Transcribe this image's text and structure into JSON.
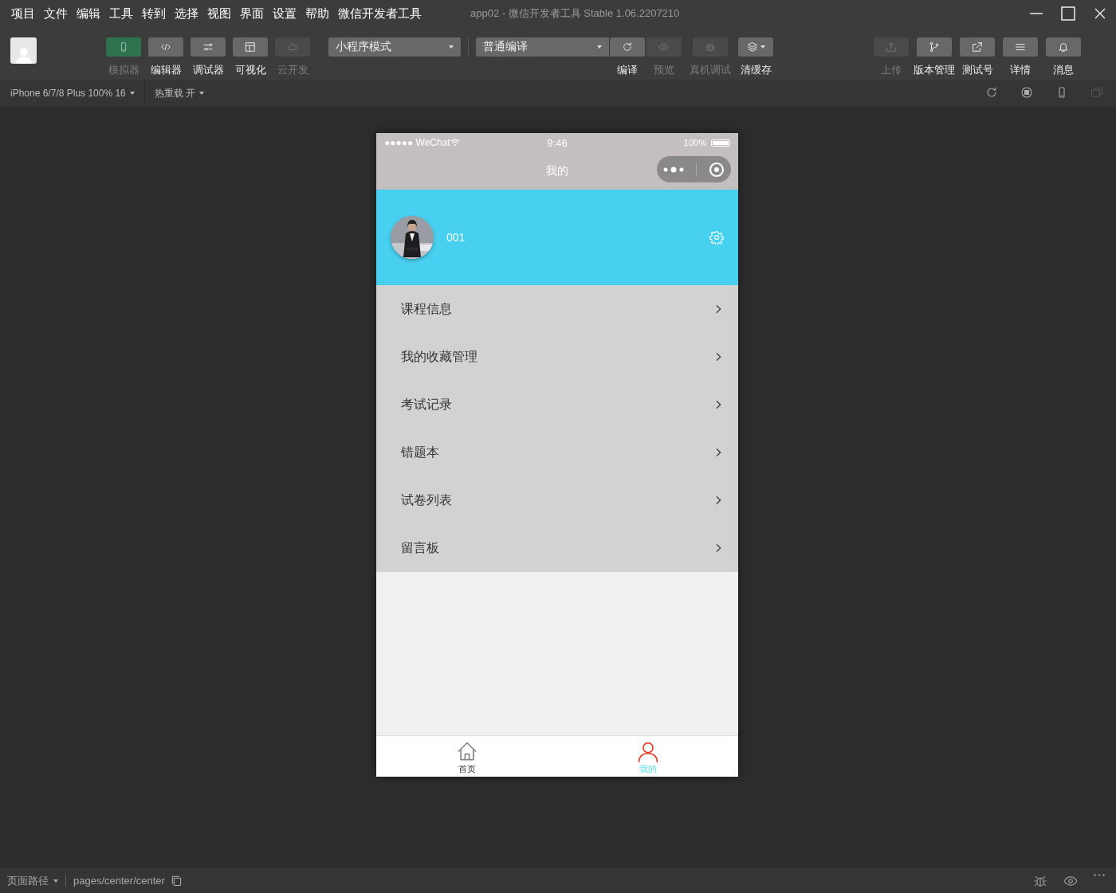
{
  "menu": [
    "项目",
    "文件",
    "编辑",
    "工具",
    "转到",
    "选择",
    "视图",
    "界面",
    "设置",
    "帮助",
    "微信开发者工具"
  ],
  "window": {
    "title": "app02 - 微信开发者工具 Stable 1.06.2207210"
  },
  "toolbar": {
    "views": [
      {
        "label": "模拟器",
        "selected": true,
        "disabled": false
      },
      {
        "label": "编辑器",
        "selected": false,
        "disabled": false
      },
      {
        "label": "调试器",
        "selected": false,
        "disabled": false
      },
      {
        "label": "可视化",
        "selected": false,
        "disabled": false
      },
      {
        "label": "云开发",
        "selected": false,
        "disabled": true
      }
    ],
    "mode_select": "小程序模式",
    "compile_select": "普通编译",
    "actions": [
      {
        "label": "编译",
        "disabled": false
      },
      {
        "label": "预览",
        "disabled": true
      },
      {
        "label": "真机调试",
        "disabled": true
      },
      {
        "label": "清缓存",
        "disabled": false
      }
    ],
    "right_actions": [
      {
        "label": "上传",
        "disabled": true
      },
      {
        "label": "版本管理",
        "disabled": false
      },
      {
        "label": "测试号",
        "disabled": false
      },
      {
        "label": "详情",
        "disabled": false
      },
      {
        "label": "消息",
        "disabled": false
      }
    ]
  },
  "device_bar": {
    "device": "iPhone 6/7/8 Plus 100% 16",
    "hot_reload": "热重载 开"
  },
  "phone": {
    "status": {
      "carrier": "●●●●● WeChat",
      "time": "9:46",
      "battery": "100%"
    },
    "nav_title": "我的",
    "profile": {
      "name": "001"
    },
    "menu": [
      "课程信息",
      "我的收藏管理",
      "考试记录",
      "错题本",
      "试卷列表",
      "留言板"
    ],
    "tabs": [
      {
        "label": "首页",
        "selected": false
      },
      {
        "label": "我的",
        "selected": true
      }
    ]
  },
  "status_bar": {
    "path_label": "页面路径",
    "path": "pages/center/center"
  }
}
